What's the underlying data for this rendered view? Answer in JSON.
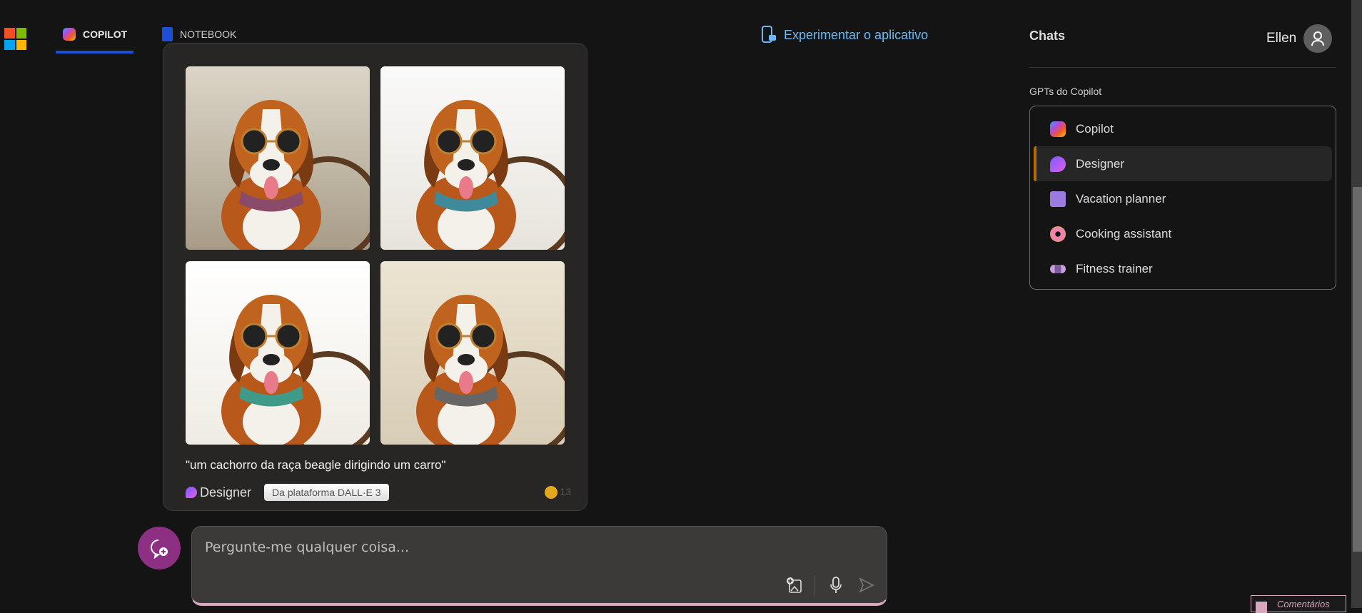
{
  "nav": {
    "tabs": [
      {
        "label": "COPILOT",
        "icon": "copilot-icon",
        "active": true
      },
      {
        "label": "NOTEBOOK",
        "icon": "notebook-icon",
        "active": false
      }
    ],
    "try_app": "Experimentar o aplicativo"
  },
  "sidebar": {
    "chats_title": "Chats",
    "user_name": "Ellen",
    "gpts_title": "GPTs do Copilot",
    "gpts": [
      {
        "label": "Copilot",
        "icon": "copilot-icon",
        "selected": false
      },
      {
        "label": "Designer",
        "icon": "designer-icon",
        "selected": true
      },
      {
        "label": "Vacation planner",
        "icon": "suitcase-icon",
        "selected": false
      },
      {
        "label": "Cooking assistant",
        "icon": "donut-icon",
        "selected": false
      },
      {
        "label": "Fitness trainer",
        "icon": "dumbbell-icon",
        "selected": false
      }
    ]
  },
  "card": {
    "caption": "\"um cachorro da raça beagle dirigindo um carro\"",
    "designer_label": "Designer",
    "dalle_badge": "Da plataforma DALL·E 3",
    "boosts": "13",
    "images": [
      "beagle-driving-1",
      "beagle-driving-2",
      "beagle-driving-3",
      "beagle-driving-4"
    ]
  },
  "composer": {
    "placeholder": "Pergunte-me qualquer coisa..."
  },
  "feedback": {
    "label": "Comentários"
  },
  "colors": {
    "accent": "#1d4ed8",
    "link": "#6cb8f6",
    "selected_bar": "#b96a00",
    "new_chat": "#8d2f82"
  }
}
